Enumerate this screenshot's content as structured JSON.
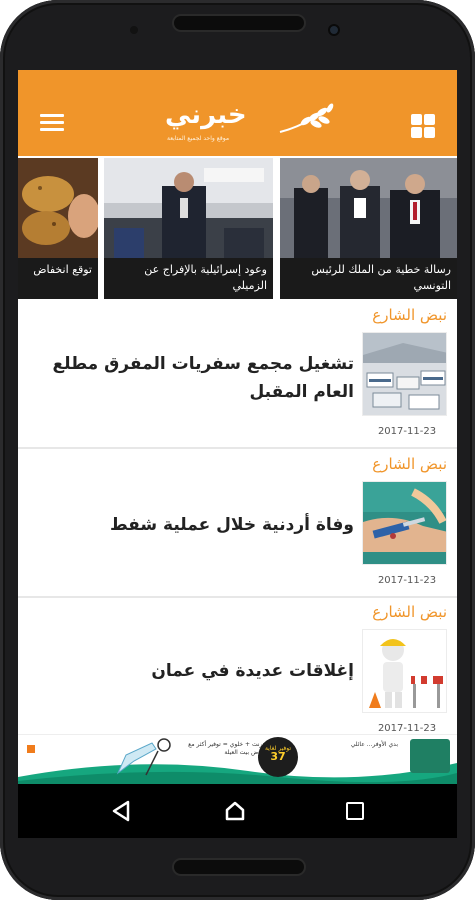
{
  "app": {
    "logo_text": "خبرني",
    "logo_tagline": "موقع واحد لجميع المتابعة"
  },
  "header": {
    "menu_icon": "hamburger-menu-icon",
    "grid_icon": "grid-view-icon",
    "accent_color": "#f0952a"
  },
  "carousel": {
    "slides": [
      {
        "caption": "رسالة خطية من الملك للرئيس التونسي"
      },
      {
        "caption": "وعود إسرائيلية بالإفراج عن الزميلي"
      },
      {
        "caption": "توقع انخفاض"
      }
    ]
  },
  "articles": [
    {
      "category": "نبض الشارع",
      "headline": "تشغيل مجمع سفريات المفرق مطلع العام المقبل",
      "date": "2017-11-23"
    },
    {
      "category": "نبض الشارع",
      "headline": "وفاة أردنية خلال عملية شفط",
      "date": "2017-11-23"
    },
    {
      "category": "نبض الشارع",
      "headline": "إغلاقات عديدة في عمان",
      "date": "2017-11-23"
    }
  ],
  "ad": {
    "left_text": "إنترنت + خلوي = توفير أكثر مع عروض بيت العيلة",
    "promo_text": "توفير لغاية",
    "promo_number": "37",
    "right_text": "بدي الأوفر... عائلي"
  },
  "navbar": {
    "back_icon": "back-triangle-icon",
    "home_icon": "home-circle-icon",
    "recent_icon": "recent-apps-square-icon"
  }
}
